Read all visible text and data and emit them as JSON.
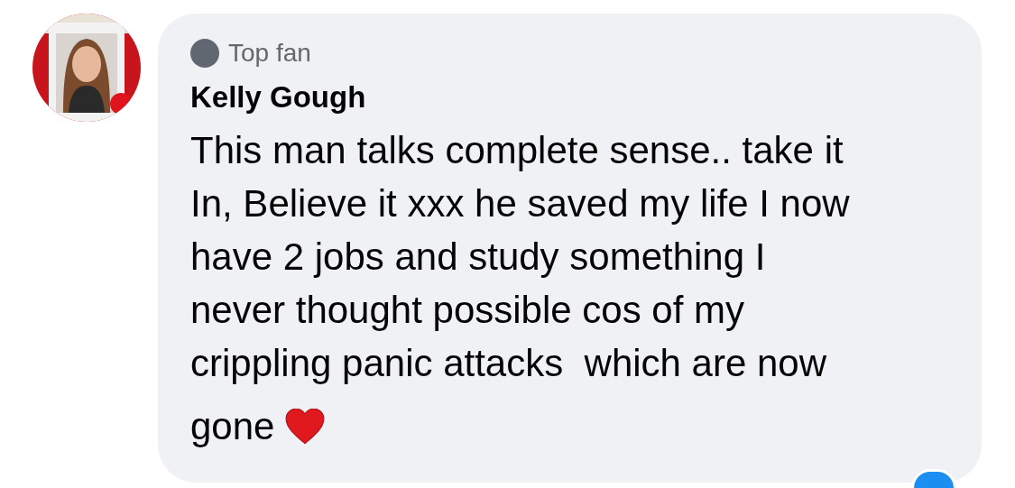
{
  "comment": {
    "badge": "Top fan",
    "author": "Kelly Gough",
    "lines": [
      "This man talks complete sense.. take it",
      "In, Believe it xxx he saved my life I now",
      "have 2 jobs and study something I",
      "never thought possible cos of my",
      "crippling panic attacks  which are now",
      "gone"
    ]
  }
}
